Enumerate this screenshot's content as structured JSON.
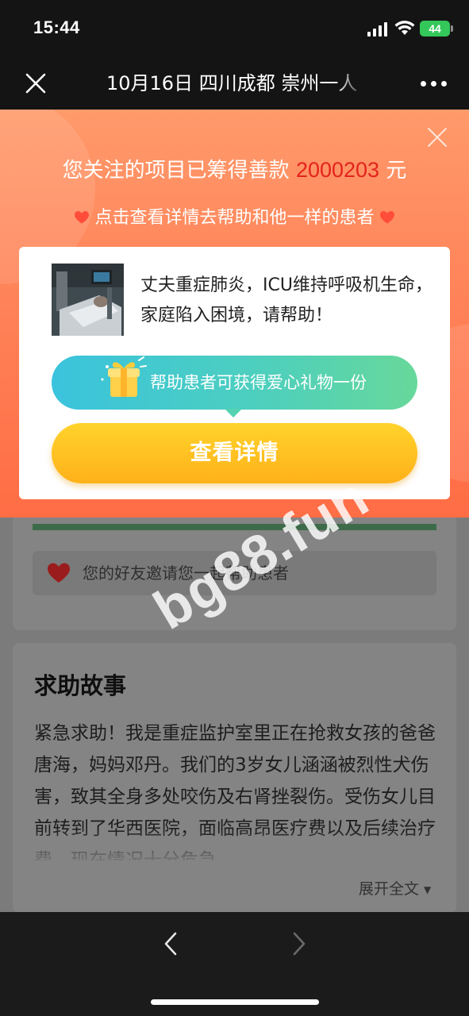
{
  "status_bar": {
    "time": "15:44",
    "battery": "44"
  },
  "title_bar": {
    "title": "10月16日 四川成都 崇州一人"
  },
  "popup": {
    "headline_prefix": "您关注的项目已筹得善款 ",
    "amount": "2000203",
    "headline_suffix": " 元",
    "subline": "点击查看详情去帮助和他一样的患者",
    "case_title": "丈夫重症肺炎，ICU维持呼吸机生命，家庭陷入困境，请帮助！",
    "gift_text": "帮助患者可获得爱心礼物一份",
    "detail_button": "查看详情"
  },
  "page": {
    "invite_text": "您的好友邀请您一起帮助患者",
    "story_title": "求助故事",
    "story_body": "紧急求助！我是重症监护室里正在抢救女孩的爸爸唐海，妈妈邓丹。我们的3岁女儿涵涵被烈性犬伤害，致其全身多处咬伤及右肾挫裂伤。受伤女儿目前转到了华西医院，面临高昂医疗费以及后续治疗费，现在情况十分危急",
    "expand_text": "展开全文"
  },
  "watermark": "bg88.fun",
  "colors": {
    "accent_orange": "#ff8359",
    "amount_red": "#e4231c",
    "button_yellow": "#ffc020",
    "banner_teal": "#3ac3dd"
  }
}
